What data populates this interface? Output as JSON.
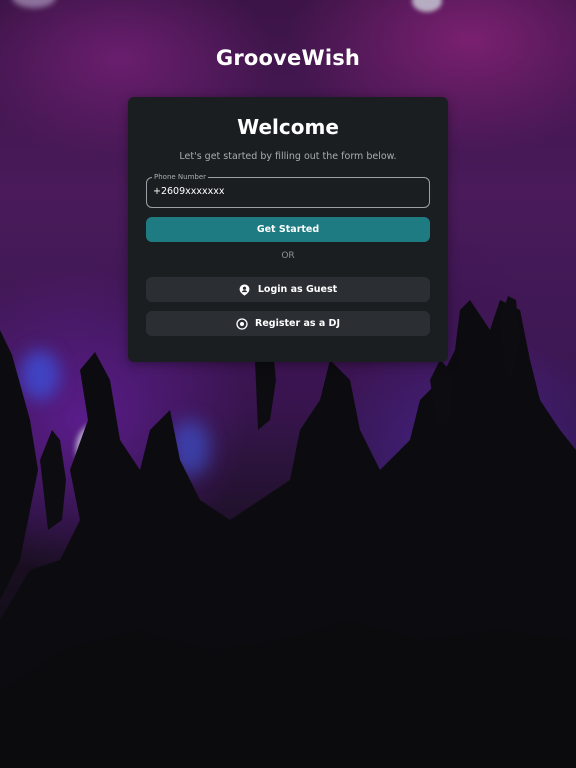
{
  "app": {
    "brand": "GrooveWish"
  },
  "card": {
    "title": "Welcome",
    "subtitle": "Let's get started by filling out the form below.",
    "phone_field": {
      "label": "Phone Number",
      "value": "+2609xxxxxxx"
    },
    "get_started_label": "Get Started",
    "divider_text": "OR",
    "guest_button": {
      "label": "Login as Guest",
      "icon": "user-pin-icon"
    },
    "dj_button": {
      "label": "Register as a DJ",
      "icon": "record-icon"
    }
  },
  "colors": {
    "card_background": "#1b1e21",
    "primary_button": "#1e7b82",
    "secondary_button": "#2b2f34",
    "page_background": "#3c1447"
  }
}
